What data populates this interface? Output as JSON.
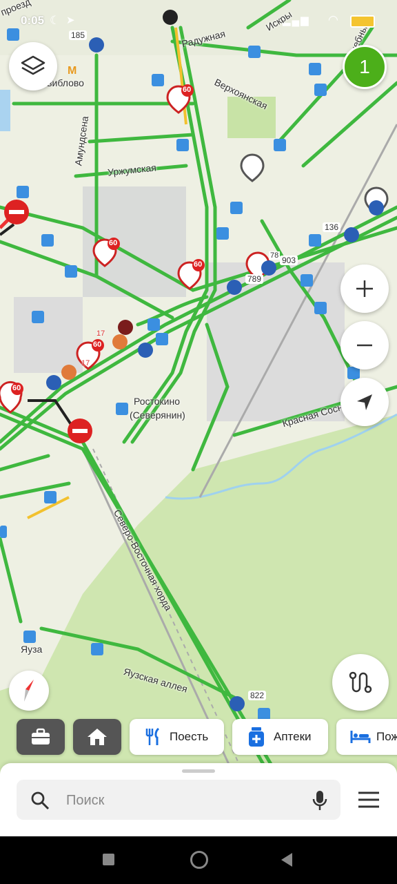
{
  "status_bar": {
    "time": "0:05"
  },
  "map": {
    "labels": {
      "raduzhnaya": "Радужная",
      "verkhoyanskaya": "Верхоянская",
      "urzhumskaya": "Уржумская",
      "amundsena": "Амундсена",
      "sviblovo": "Свиблово",
      "rostokino": "Ростокино",
      "severyanin": "(Северянин)",
      "severo_vostochnaya_khorda": "Северо-Восточная хорда",
      "yauzskaya_alleya": "Яузская аллея",
      "krasnaya_sosna": "Красная Сосна",
      "yauza": "Яуза",
      "iskry": "Искры",
      "lechebny": "Лечебный",
      "proezd": "проезд"
    },
    "route_numbers": {
      "r185": "185",
      "r136": "136",
      "r789": "789",
      "r903": "903",
      "r822": "822",
      "r17a": "17",
      "r17b": "17",
      "r78": "78"
    },
    "speed_limits": [
      "60",
      "60",
      "60",
      "60",
      "60"
    ]
  },
  "notification_count": "1",
  "categories": {
    "eat": "Поесть",
    "pharmacies": "Аптеки",
    "lodging": "Пож"
  },
  "search": {
    "placeholder": "Поиск"
  },
  "colors": {
    "traffic_green": "#3fb83f",
    "accent_green": "#4caf1a",
    "road_block_red": "#d22"
  }
}
